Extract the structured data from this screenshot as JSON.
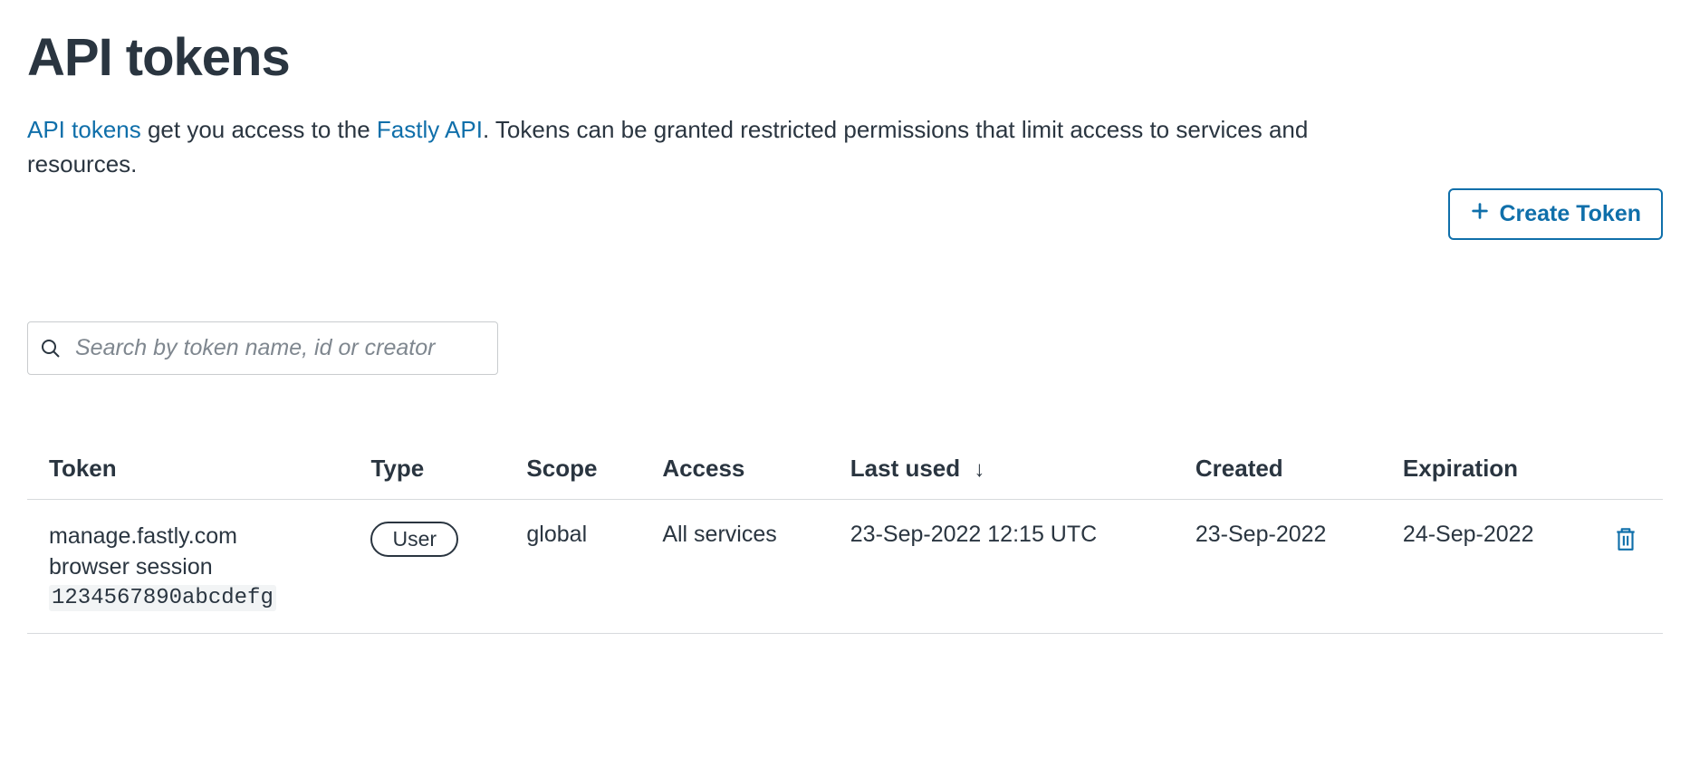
{
  "page": {
    "title": "API tokens",
    "desc_link1": "API tokens",
    "desc_mid": " get you access to the ",
    "desc_link2": "Fastly API",
    "desc_tail": ". Tokens can be granted restricted permissions that limit access to services and resources.",
    "create_button": "Create Token",
    "search_placeholder": "Search by token name, id or creator"
  },
  "table": {
    "headers": {
      "token": "Token",
      "type": "Type",
      "scope": "Scope",
      "access": "Access",
      "last_used": "Last used",
      "created": "Created",
      "expiration": "Expiration"
    },
    "sort_indicator": "↓",
    "rows": [
      {
        "name_line1": "manage.fastly.com",
        "name_line2": "browser session",
        "id": "1234567890abcdefg",
        "type": "User",
        "scope": "global",
        "access": "All services",
        "last_used": "23-Sep-2022 12:15 UTC",
        "created": "23-Sep-2022",
        "expiration": "24-Sep-2022"
      }
    ]
  }
}
